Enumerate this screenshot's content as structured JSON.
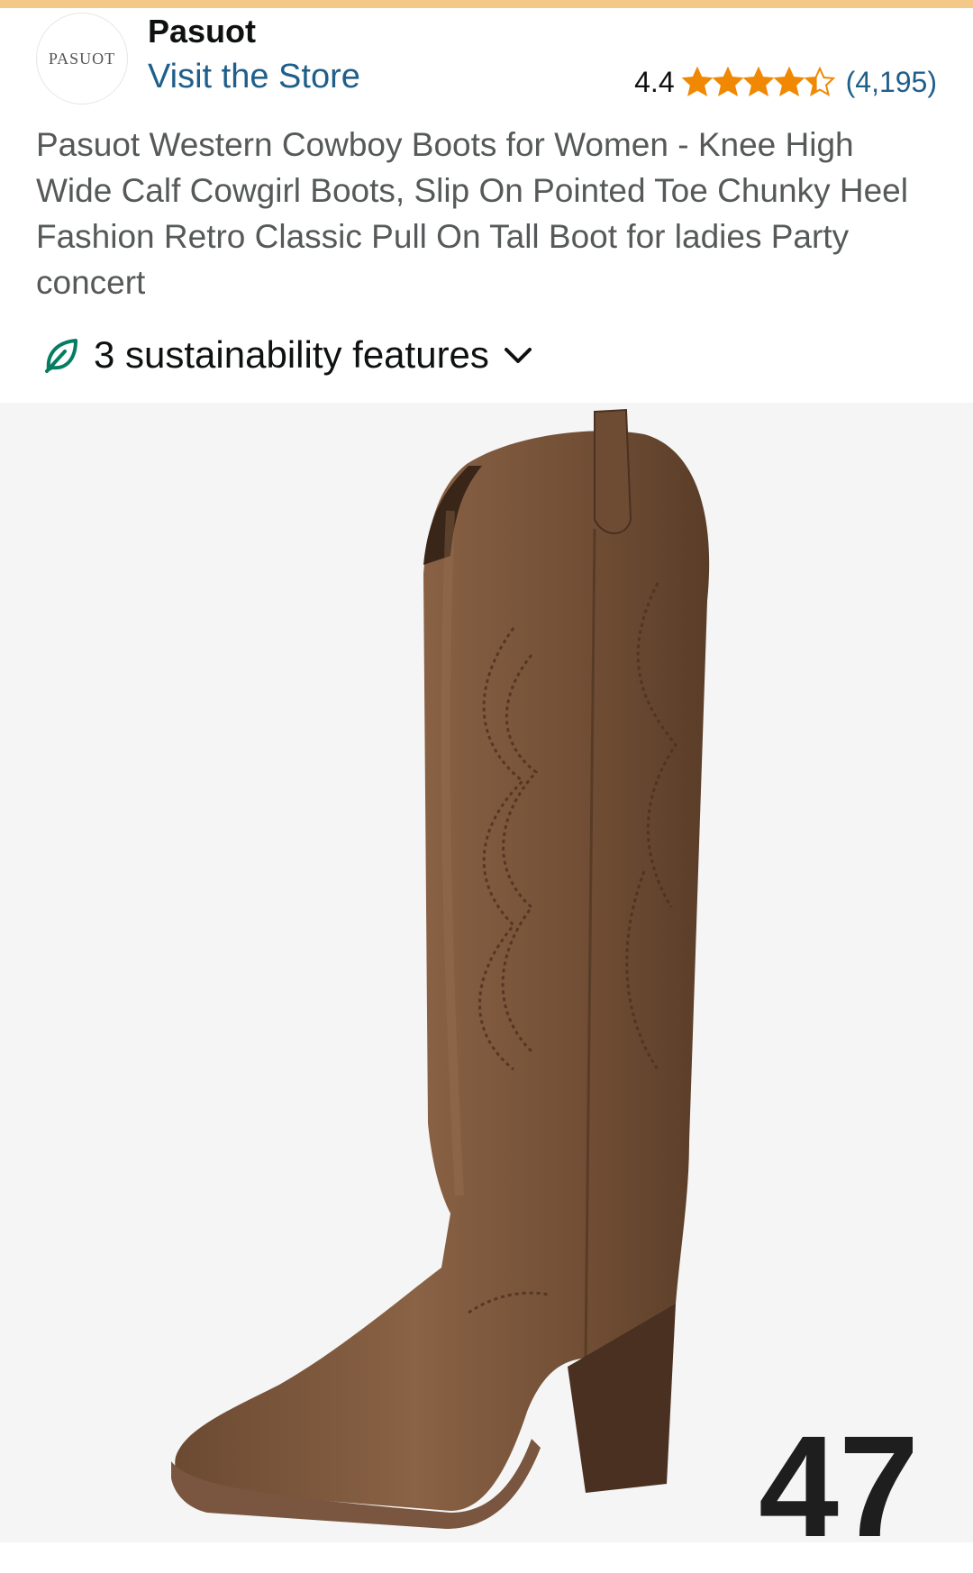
{
  "store": {
    "logo_text": "PASUOT",
    "brand_name": "Pasuot",
    "visit_link": "Visit the Store"
  },
  "rating": {
    "value": "4.4",
    "stars": 4.4,
    "count": "(4,195)",
    "star_color": "#f08804",
    "link_color": "#1f5f8b"
  },
  "product": {
    "title": "Pasuot Western Cowboy Boots for Women - Knee High Wide Calf Cowgirl Boots, Slip On Pointed Toe Chunky Heel Fashion Retro Classic Pull On Tall Boot for ladies Party concert"
  },
  "sustainability": {
    "label": "3 sustainability features",
    "icon": "leaf-icon",
    "icon_color": "#067d62"
  },
  "image": {
    "overlay_number": "47",
    "alt": "brown western cowboy boot"
  }
}
